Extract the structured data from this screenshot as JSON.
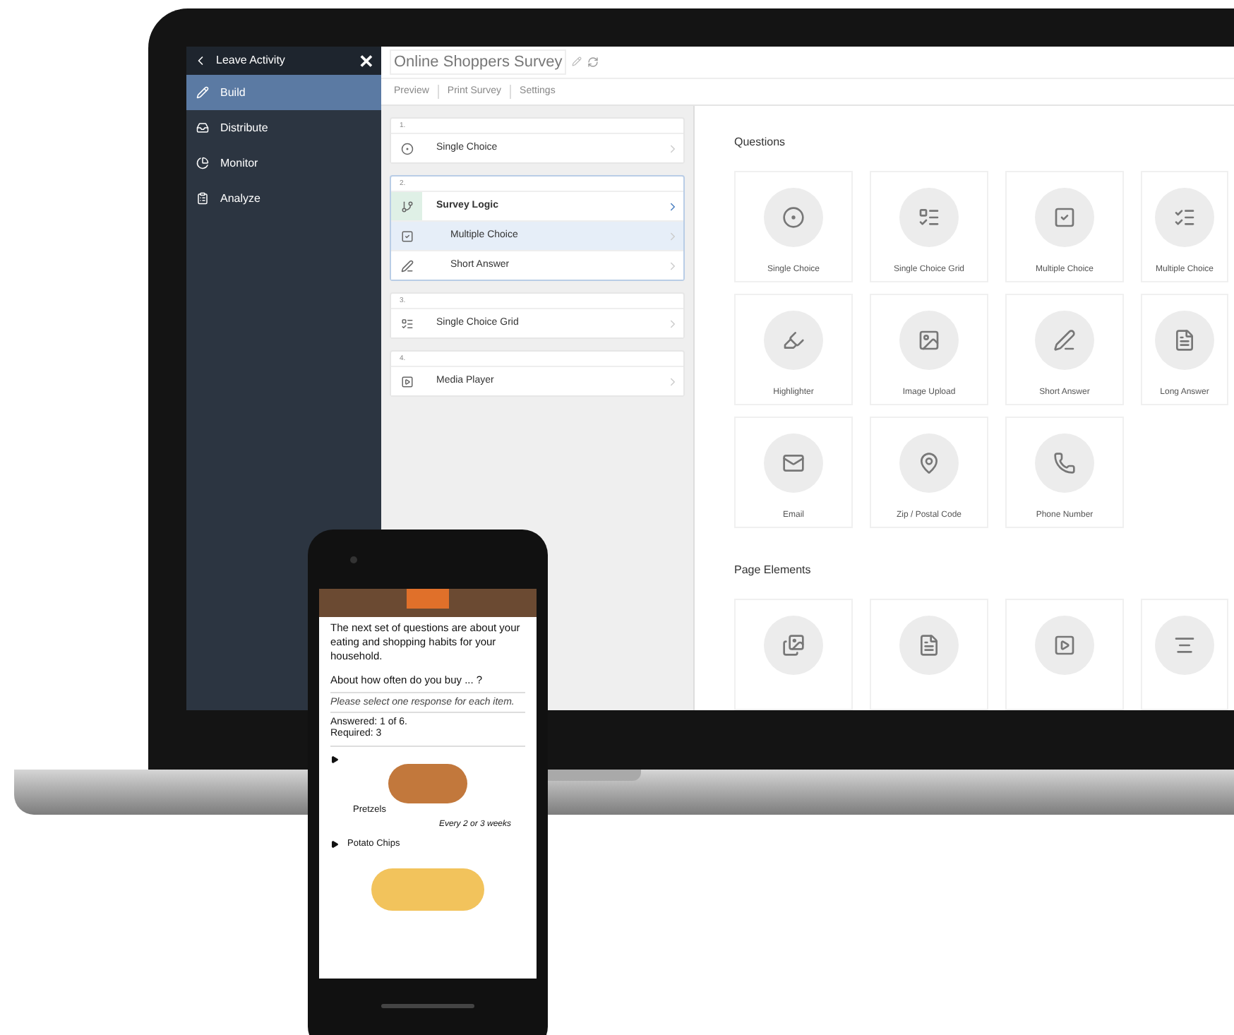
{
  "sidebar": {
    "back": "Leave Activity",
    "close": "✕",
    "items": [
      {
        "label": "Build",
        "kind": "build",
        "selected": true
      },
      {
        "label": "Distribute",
        "kind": "distribute",
        "selected": false
      },
      {
        "label": "Monitor",
        "kind": "monitor",
        "selected": false
      },
      {
        "label": "Analyze",
        "kind": "analyze",
        "selected": false
      }
    ]
  },
  "header": {
    "title": "Online Shoppers Survey",
    "tabs": [
      "Preview",
      "Print Survey",
      "Settings"
    ]
  },
  "outline": [
    {
      "number": "1.",
      "items": [
        {
          "label": "Single Choice",
          "kind": "single",
          "selected": false
        }
      ]
    },
    {
      "number": "2.",
      "items": [
        {
          "label": "Survey Logic",
          "kind": "logic",
          "selected": false,
          "children": [
            {
              "label": "Multiple Choice",
              "kind": "multiple",
              "selected": true
            },
            {
              "label": "Short Answer",
              "kind": "short",
              "selected": false
            }
          ]
        }
      ]
    },
    {
      "number": "3.",
      "items": [
        {
          "label": "Single Choice Grid",
          "kind": "grid",
          "selected": false
        }
      ]
    },
    {
      "number": "4.",
      "items": [
        {
          "label": "Media Player",
          "kind": "media",
          "selected": false
        }
      ]
    }
  ],
  "palette": {
    "questions_title": "Questions",
    "questions": [
      {
        "label": "Single Choice",
        "kind": "single"
      },
      {
        "label": "Single Choice Grid",
        "kind": "grid"
      },
      {
        "label": "Multiple Choice",
        "kind": "multiple"
      },
      {
        "label": "Multiple Choice",
        "kind": "multigrid"
      },
      {
        "label": "Highlighter",
        "kind": "highlighter"
      },
      {
        "label": "Image Upload",
        "kind": "image"
      },
      {
        "label": "Short Answer",
        "kind": "short"
      },
      {
        "label": "Long Answer",
        "kind": "long"
      },
      {
        "label": "Email",
        "kind": "email"
      },
      {
        "label": "Zip / Postal Code",
        "kind": "zip"
      },
      {
        "label": "Phone Number",
        "kind": "phone"
      }
    ],
    "elements_title": "Page Elements",
    "elements": [
      {
        "kind": "textimage"
      },
      {
        "kind": "text"
      },
      {
        "kind": "media"
      },
      {
        "kind": "divider"
      }
    ]
  },
  "phone": {
    "intro": "The next set of questions are about your eating and shopping habits for your household.",
    "question": "About how often do you buy ... ?",
    "instruction": "Please select one response for each item.",
    "answered": "Answered: 1 of 6.",
    "required": "Required: 3",
    "items": [
      {
        "label": "Pretzels",
        "answer": "Every 2 or 3 weeks",
        "kind": "pretzels"
      },
      {
        "label": "Potato Chips",
        "kind": "chips"
      }
    ]
  }
}
